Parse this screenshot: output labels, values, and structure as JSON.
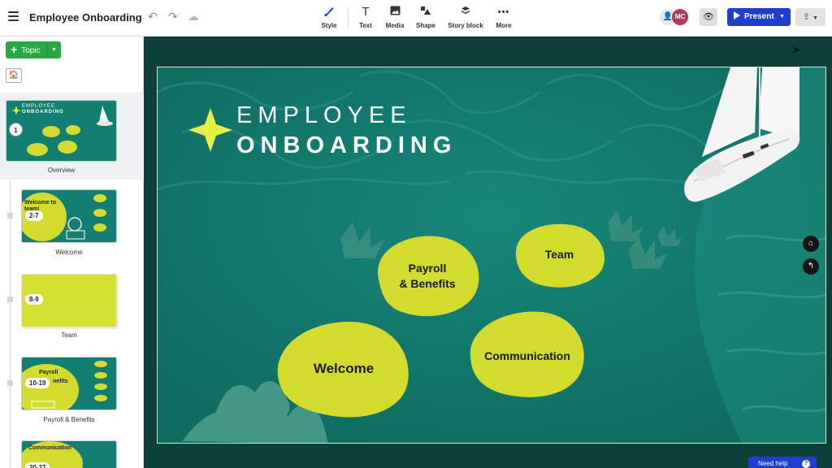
{
  "app": {
    "doc_title": "Employee Onboarding"
  },
  "toolbar": {
    "tools": [
      {
        "label": "Style",
        "icon": "brush-icon"
      },
      {
        "label": "Text",
        "icon": "text-icon"
      },
      {
        "label": "Media",
        "icon": "image-icon"
      },
      {
        "label": "Shape",
        "icon": "shape-icon"
      },
      {
        "label": "Story block",
        "icon": "layers-icon"
      },
      {
        "label": "More",
        "icon": "dots-icon"
      }
    ],
    "avatar_initials": "MC",
    "present_label": "Present"
  },
  "sidebar": {
    "topic_label": "Topic",
    "items": [
      {
        "label": "Overview",
        "badge": "1"
      },
      {
        "label": "Welcome",
        "badge": "2-7"
      },
      {
        "label": "Team",
        "badge": "8-9"
      },
      {
        "label": "Payroll & Benefits",
        "badge": "10-19"
      },
      {
        "label": "",
        "badge": "20-27"
      }
    ],
    "thumb_text": {
      "overview_title_1": "EMPLOYEE",
      "overview_title_2": "ONBOARDING",
      "welcome_heading_1": "Welcome to",
      "welcome_heading_2": "team!",
      "payroll_heading_1": "Payroll",
      "payroll_heading_2": "nefits",
      "comm_heading": "Communication"
    }
  },
  "canvas": {
    "title_line1": "EMPLOYEE",
    "title_line2": "ONBOARDING",
    "topics": {
      "payroll_1": "Payroll",
      "payroll_2": "& Benefits",
      "team": "Team",
      "welcome": "Welcome",
      "communication": "Communication"
    }
  },
  "footer": {
    "help_label": "Need help"
  },
  "colors": {
    "ocean": "#14786b",
    "island": "#d3db2e",
    "accent_star": "#e6ee46",
    "present_blue": "#1f3ecf",
    "topic_green": "#27a844"
  }
}
